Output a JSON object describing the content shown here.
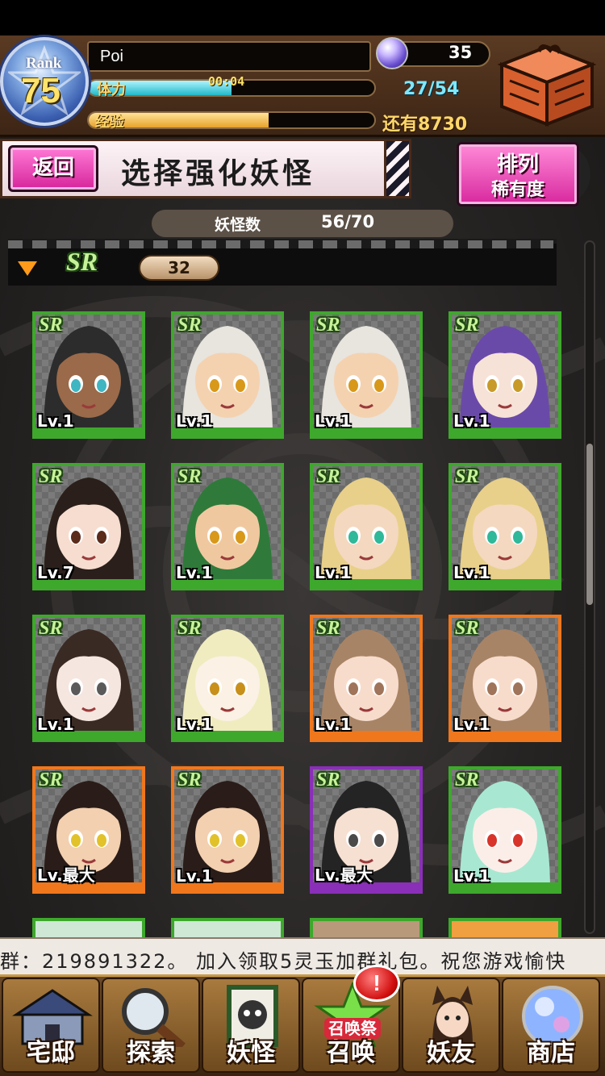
{
  "header": {
    "rank_label": "Rank",
    "rank_value": "75",
    "player_name": "Poi",
    "stamina_label": "体力",
    "stamina_timer": "00:04",
    "stamina_value": "27/54",
    "stamina_fill": 0.5,
    "exp_label": "经验",
    "exp_fill": 0.63,
    "exp_remaining": "还有8730",
    "gems": "35"
  },
  "title_bar": {
    "back_label": "返回",
    "title": "选择强化妖怪",
    "sort_line1": "排列",
    "sort_line2": "稀有度"
  },
  "monster_count": {
    "label": "妖怪数",
    "value": "56/70"
  },
  "section": {
    "rarity": "SR",
    "count": "32"
  },
  "cards": [
    {
      "rarity": "SR",
      "level": "Lv.1",
      "frame": "green",
      "hair": "#2c2c2c",
      "skin": "#9a6a4a",
      "eyes": "#3fb6c2"
    },
    {
      "rarity": "SR",
      "level": "Lv.1",
      "frame": "green",
      "hair": "#e8e4de",
      "skin": "#f4d2b0",
      "eyes": "#d8981a"
    },
    {
      "rarity": "SR",
      "level": "Lv.1",
      "frame": "green",
      "hair": "#e8e4de",
      "skin": "#f4d2b0",
      "eyes": "#d8981a"
    },
    {
      "rarity": "SR",
      "level": "Lv.1",
      "frame": "green",
      "hair": "#6a4aa8",
      "skin": "#f7e2d8",
      "eyes": "#c89a2a"
    },
    {
      "rarity": "SR",
      "level": "Lv.7",
      "frame": "green",
      "hair": "#2a1f1a",
      "skin": "#f6ddd0",
      "eyes": "#5a2a1a"
    },
    {
      "rarity": "SR",
      "level": "Lv.1",
      "frame": "green",
      "hair": "#2f7a3a",
      "skin": "#f0c8a0",
      "eyes": "#d8981a"
    },
    {
      "rarity": "SR",
      "level": "Lv.1",
      "frame": "green",
      "hair": "#e8d08a",
      "skin": "#f4d8c0",
      "eyes": "#2fb89a"
    },
    {
      "rarity": "SR",
      "level": "Lv.1",
      "frame": "green",
      "hair": "#e8d08a",
      "skin": "#f4d8c0",
      "eyes": "#2fb89a"
    },
    {
      "rarity": "SR",
      "level": "Lv.1",
      "frame": "green",
      "hair": "#3a2a24",
      "skin": "#f6e6e0",
      "eyes": "#5a5a5a"
    },
    {
      "rarity": "SR",
      "level": "Lv.1",
      "frame": "green",
      "hair": "#f0ecc0",
      "skin": "#fbf1e4",
      "eyes": "#c8901a"
    },
    {
      "rarity": "SR",
      "level": "Lv.1",
      "frame": "orange",
      "hair": "#a88466",
      "skin": "#f7dccc",
      "eyes": "#a0745a"
    },
    {
      "rarity": "SR",
      "level": "Lv.1",
      "frame": "orange",
      "hair": "#a88466",
      "skin": "#f7dccc",
      "eyes": "#a0745a"
    },
    {
      "rarity": "SR",
      "level": "Lv.最大",
      "frame": "orange",
      "hair": "#2a1c18",
      "skin": "#f2d0b0",
      "eyes": "#e2c22a"
    },
    {
      "rarity": "SR",
      "level": "Lv.1",
      "frame": "orange",
      "hair": "#2a1c18",
      "skin": "#f2d0b0",
      "eyes": "#e2c22a"
    },
    {
      "rarity": "SR",
      "level": "Lv.最大",
      "frame": "purple",
      "hair": "#242424",
      "skin": "#f6e0d2",
      "eyes": "#4a4a4a"
    },
    {
      "rarity": "SR",
      "level": "Lv.1",
      "frame": "green",
      "hair": "#a8e8d2",
      "skin": "#fbeee8",
      "eyes": "#d8342a"
    }
  ],
  "ticker": {
    "text": "群：219891322。    加入领取5灵玉加群礼包。祝您游戏愉快"
  },
  "bottom_nav": [
    {
      "label": "宅邸",
      "icon": "mansion-icon"
    },
    {
      "label": "探索",
      "icon": "magnifier-icon"
    },
    {
      "label": "妖怪",
      "icon": "monster-scroll-icon"
    },
    {
      "label": "召唤",
      "icon": "summon-star-icon",
      "badge": "!",
      "icon_caption": "召唤祭"
    },
    {
      "label": "妖友",
      "icon": "friend-catgirl-icon"
    },
    {
      "label": "商店",
      "icon": "shop-orb-icon"
    }
  ],
  "colors": {
    "frame_green": "#3ea82c",
    "frame_orange": "#f0771c",
    "frame_purple": "#8a2fb8",
    "accent_pink": "#d6249a",
    "stamina": "#22b9c8",
    "exp": "#e8a12a"
  }
}
